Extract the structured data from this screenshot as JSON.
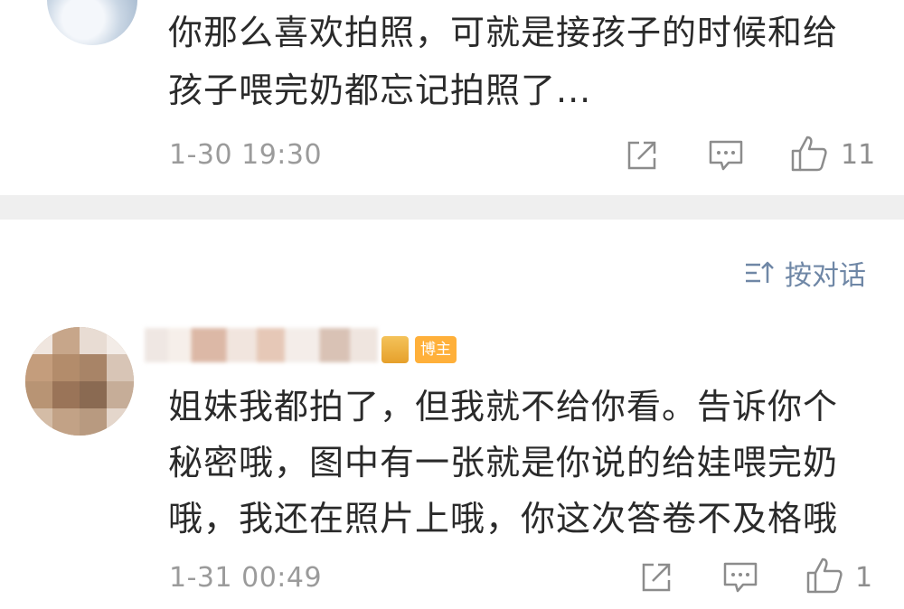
{
  "comment1": {
    "text_line1": "你那么喜欢拍照，可就是接孩子的时候和给",
    "text_line2": "孩子喂完奶都忘记拍照了...",
    "time": "1-30 19:30",
    "like_count": "11"
  },
  "sort_label": "按对话",
  "comment2": {
    "author_badge": "博主",
    "text_line1": "姐妹我都拍了，但我就不给你看。告诉你个",
    "text_line2": "秘密哦，图中有一张就是你说的给娃喂完奶",
    "text_line3": "哦，我还在照片上哦，你这次答卷不及格哦",
    "time": "1-31 00:49",
    "like_count": "1"
  },
  "icons": {
    "share": "share-icon",
    "reply": "reply-comment-icon",
    "like": "thumb-up-icon",
    "sort": "sort-conversation-icon"
  },
  "colors": {
    "link_blue": "#6f87a6",
    "badge_orange": "#ffb03a",
    "divider": "#efefef",
    "meta_gray": "#9b9b9b"
  }
}
